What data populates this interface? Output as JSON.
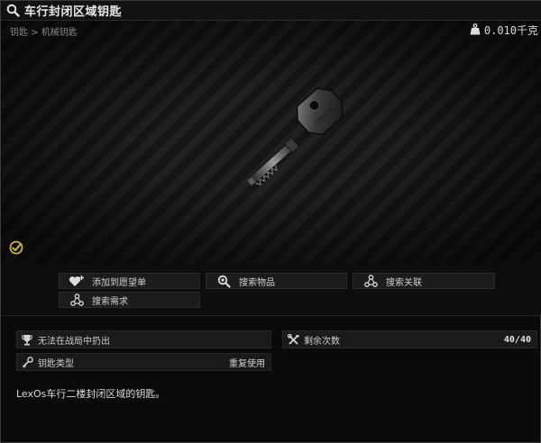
{
  "window": {
    "title": "车行封闭区域钥匙",
    "icon": "search-icon"
  },
  "item": {
    "breadcrumb": "钥匙 > 机械钥匙",
    "weight": "0.010千克",
    "weight_icon": "weight-icon",
    "tag_text": "LexOs",
    "checked_icon": "check-circle-icon"
  },
  "actions": {
    "add_wishlist": "添加到愿望单",
    "search_item": "搜索物品",
    "search_related": "搜索关联",
    "search_requirements": "搜索需求"
  },
  "attributes": {
    "no_extract_label": "无法在战局中扔出",
    "uses_left_label": "剩余次数",
    "uses_left_value": "40/40",
    "key_type_label": "钥匙类型",
    "key_type_value": "重复使用"
  },
  "description": "LexOs车行二楼封闭区域的钥匙。",
  "colors": {
    "accent_yellow": "#c9b34a",
    "panel_bg": "#1a1a1a",
    "text": "#d0d0d0"
  }
}
